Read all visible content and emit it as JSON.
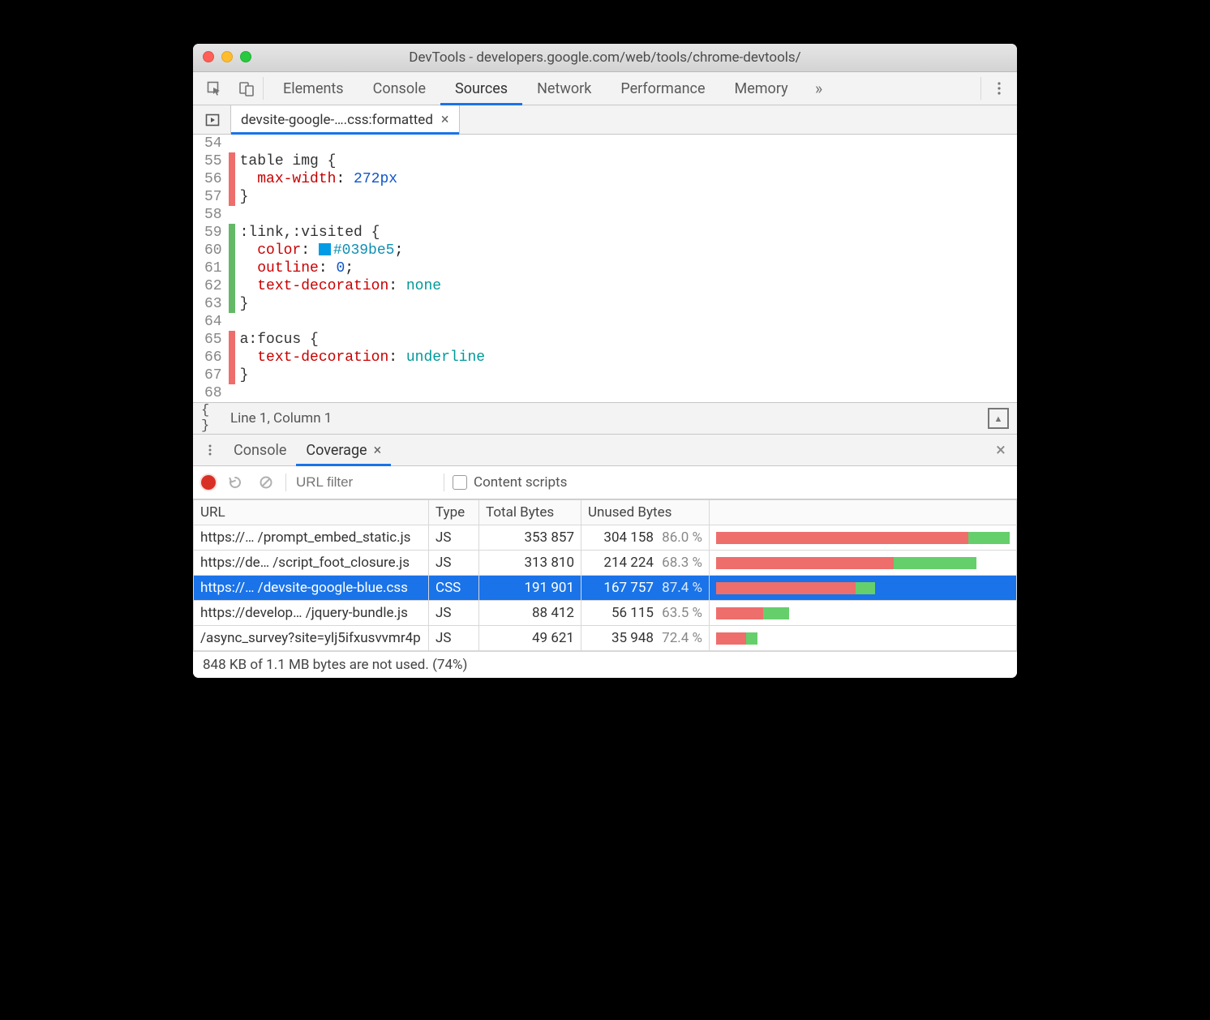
{
  "window": {
    "title": "DevTools - developers.google.com/web/tools/chrome-devtools/"
  },
  "mainTabs": {
    "items": [
      "Elements",
      "Console",
      "Sources",
      "Network",
      "Performance",
      "Memory"
    ],
    "active": "Sources"
  },
  "fileTabs": {
    "items": [
      {
        "label": "devsite-google-….css:formatted"
      }
    ]
  },
  "editor": {
    "lines": [
      {
        "n": 54,
        "cov": "",
        "text": ""
      },
      {
        "n": 55,
        "cov": "red",
        "text": "table img {"
      },
      {
        "n": 56,
        "cov": "red",
        "text": "  max-width: 272px"
      },
      {
        "n": 57,
        "cov": "red",
        "text": "}"
      },
      {
        "n": 58,
        "cov": "",
        "text": ""
      },
      {
        "n": 59,
        "cov": "green",
        "text": ":link,:visited {"
      },
      {
        "n": 60,
        "cov": "green",
        "text": "  color: #039be5;"
      },
      {
        "n": 61,
        "cov": "green",
        "text": "  outline: 0;"
      },
      {
        "n": 62,
        "cov": "green",
        "text": "  text-decoration: none"
      },
      {
        "n": 63,
        "cov": "green",
        "text": "}"
      },
      {
        "n": 64,
        "cov": "",
        "text": ""
      },
      {
        "n": 65,
        "cov": "red",
        "text": "a:focus {"
      },
      {
        "n": 66,
        "cov": "red",
        "text": "  text-decoration: underline"
      },
      {
        "n": 67,
        "cov": "red",
        "text": "}"
      },
      {
        "n": 68,
        "cov": "",
        "text": ""
      }
    ]
  },
  "statusStrip": {
    "position": "Line 1, Column 1"
  },
  "drawer": {
    "tabs": [
      "Console",
      "Coverage"
    ],
    "active": "Coverage",
    "coverage": {
      "filterPlaceholder": "URL filter",
      "contentScriptsLabel": "Content scripts",
      "columns": {
        "url": "URL",
        "type": "Type",
        "total": "Total Bytes",
        "unused": "Unused Bytes"
      },
      "rows": [
        {
          "url": "https://… /prompt_embed_static.js",
          "type": "JS",
          "total": "353 857",
          "unused": "304 158",
          "pct": "86.0 %",
          "barTotal": 100.0,
          "barUnused": 86.0
        },
        {
          "url": "https://de… /script_foot_closure.js",
          "type": "JS",
          "total": "313 810",
          "unused": "214 224",
          "pct": "68.3 %",
          "barTotal": 88.7,
          "barUnused": 60.5
        },
        {
          "url": "https://… /devsite-google-blue.css",
          "type": "CSS",
          "total": "191 901",
          "unused": "167 757",
          "pct": "87.4 %",
          "barTotal": 54.2,
          "barUnused": 47.4,
          "selected": true
        },
        {
          "url": "https://develop… /jquery-bundle.js",
          "type": "JS",
          "total": "88 412",
          "unused": "56 115",
          "pct": "63.5 %",
          "barTotal": 25.0,
          "barUnused": 15.9
        },
        {
          "url": "/async_survey?site=ylj5ifxusvvmr4p",
          "type": "JS",
          "total": "49 621",
          "unused": "35 948",
          "pct": "72.4 %",
          "barTotal": 14.0,
          "barUnused": 10.2
        }
      ],
      "footer": "848 KB of 1.1 MB bytes are not used. (74%)"
    }
  }
}
